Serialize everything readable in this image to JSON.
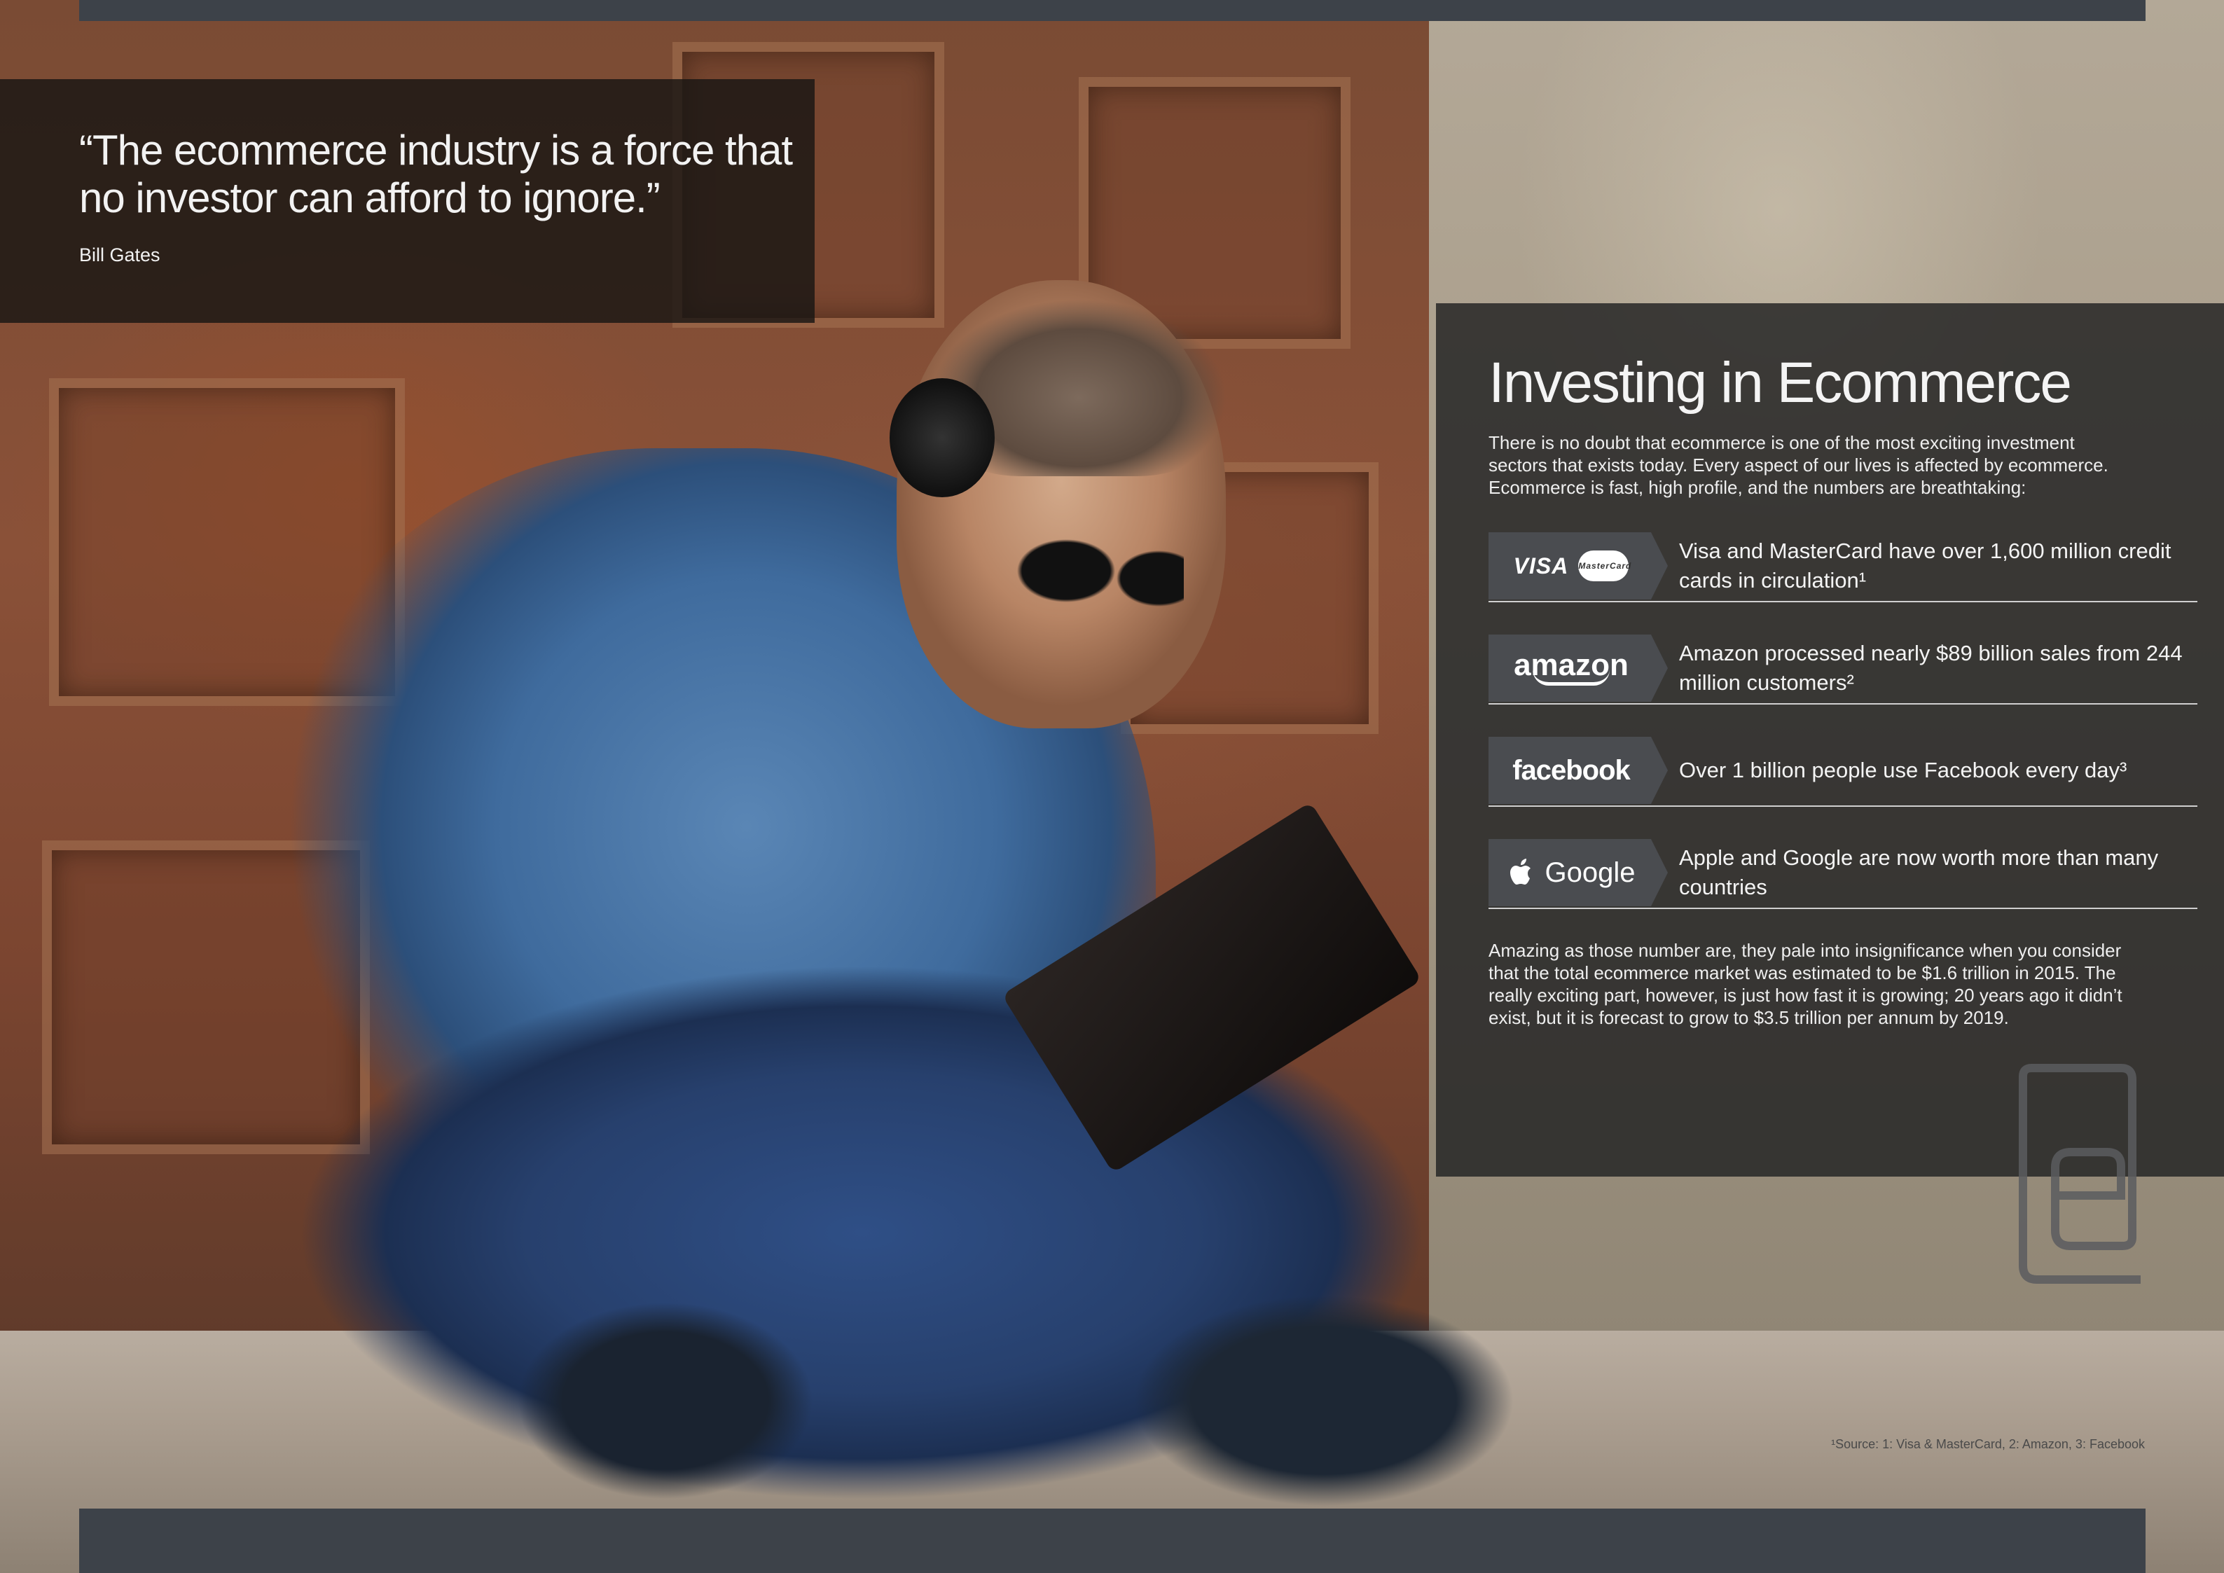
{
  "quote": {
    "text": "“The ecommerce industry is a force that no investor can afford to ignore.”",
    "author": "Bill Gates"
  },
  "panel": {
    "title": "Investing in Ecommerce",
    "intro": "There is no doubt that ecommerce is one of the most exciting investment sectors that exists today. Every aspect of our lives is affected by ecommerce. Ecommerce is fast, high profile, and the numbers are breathtaking:",
    "stats": [
      {
        "logo": "VISA",
        "logo_secondary": "MasterCard",
        "text": "Visa and MasterCard have over 1,600 million credit cards in circulation¹"
      },
      {
        "logo": "amazon",
        "text": "Amazon processed nearly $89 billion sales from 244 million customers²"
      },
      {
        "logo": "facebook",
        "text": "Over 1 billion people use Facebook every day³"
      },
      {
        "logo": "Google",
        "text": "Apple and Google are now worth more than many countries"
      }
    ],
    "outro": "Amazing as those number are, they pale into insignificance when you consider that the total ecommerce market was estimated to be $1.6 trillion in 2015. The really exciting part, however, is just how fast it is growing; 20 years ago it didn’t exist, but it is forecast to grow to $3.5 trillion per annum by 2019."
  },
  "footnote": "¹Source: 1: Visa & MasterCard, 2: Amazon, 3: Facebook",
  "icons": {
    "apple": "apple-icon",
    "brand": "brand-e-logo-icon"
  },
  "colors": {
    "bar": "#3d4249",
    "panel_bg": "#262626",
    "logo_tab": "#4a4c50"
  }
}
